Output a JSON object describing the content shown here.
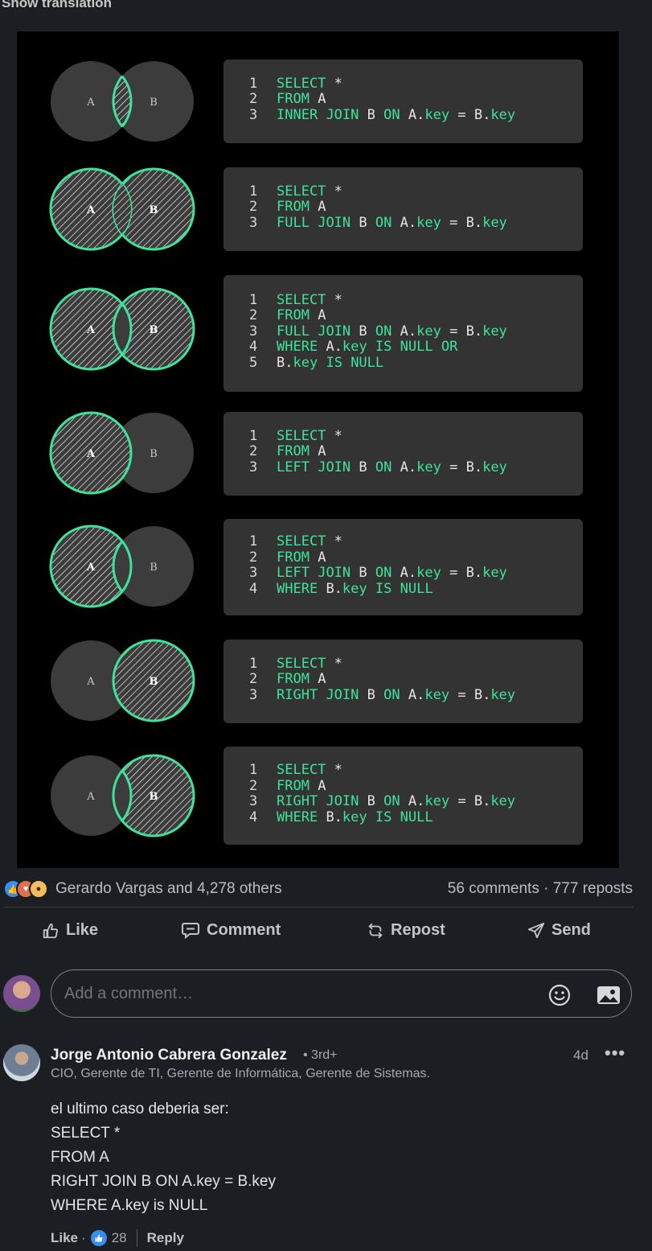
{
  "header": {
    "show_translation": "Show translation"
  },
  "figure": {
    "panels": [
      {
        "left_label": "A",
        "right_label": "B",
        "shade": "inner",
        "code": [
          [
            "1",
            "SELECT *"
          ],
          [
            "2",
            "FROM A"
          ],
          [
            "3",
            "INNER JOIN B ON A.key = B.key"
          ]
        ]
      },
      {
        "left_label": "A",
        "right_label": "B",
        "shade": "full",
        "code": [
          [
            "1",
            "SELECT *"
          ],
          [
            "2",
            "FROM A"
          ],
          [
            "3",
            "FULL JOIN B ON A.key = B.key"
          ]
        ]
      },
      {
        "left_label": "A",
        "right_label": "B",
        "shade": "full-outer",
        "code": [
          [
            "1",
            "SELECT *"
          ],
          [
            "2",
            "FROM A"
          ],
          [
            "3",
            "FULL JOIN B ON A.key = B.key"
          ],
          [
            "4",
            "WHERE A.key IS NULL OR"
          ],
          [
            "5",
            "B.key IS NULL"
          ]
        ]
      },
      {
        "left_label": "A",
        "right_label": "B",
        "shade": "left",
        "code": [
          [
            "1",
            "SELECT *"
          ],
          [
            "2",
            "FROM A"
          ],
          [
            "3",
            "LEFT JOIN B ON A.key = B.key"
          ]
        ]
      },
      {
        "left_label": "A",
        "right_label": "B",
        "shade": "left-only",
        "code": [
          [
            "1",
            "SELECT *"
          ],
          [
            "2",
            "FROM A"
          ],
          [
            "3",
            "LEFT JOIN B ON A.key = B.key"
          ],
          [
            "4",
            "WHERE B.key IS NULL"
          ]
        ]
      },
      {
        "left_label": "A",
        "right_label": "B",
        "shade": "right",
        "code": [
          [
            "1",
            "SELECT *"
          ],
          [
            "2",
            "FROM A"
          ],
          [
            "3",
            "RIGHT JOIN B ON A.key = B.key"
          ]
        ]
      },
      {
        "left_label": "A",
        "right_label": "B",
        "shade": "right-only",
        "code": [
          [
            "1",
            "SELECT *"
          ],
          [
            "2",
            "FROM A"
          ],
          [
            "3",
            "RIGHT JOIN B ON A.key = B.key"
          ],
          [
            "4",
            "WHERE B.key IS NULL"
          ]
        ]
      }
    ],
    "colors": {
      "accent": "#3ee39a",
      "circle": "#3c3c3c",
      "background": "#000000",
      "code_bg": "#333333"
    }
  },
  "social": {
    "reaction_icons": [
      "like-icon",
      "love-icon",
      "insightful-icon"
    ],
    "reactors": "Gerardo Vargas and 4,278 others",
    "stats": "56 comments · 777 reposts"
  },
  "actions": {
    "like": "Like",
    "comment": "Comment",
    "repost": "Repost",
    "send": "Send"
  },
  "composer": {
    "placeholder": "Add a comment…"
  },
  "comment": {
    "author": "Jorge Antonio Cabrera Gonzalez",
    "degree": "• 3rd+",
    "headline": "CIO, Gerente de TI, Gerente de Informática, Gerente de Sistemas.",
    "time": "4d",
    "more": "•••",
    "body": "el ultimo caso deberia ser:\nSELECT *\nFROM A\nRIGHT JOIN B ON A.key = B.key\nWHERE A.key is NULL",
    "like_label": "Like",
    "dot": "·",
    "like_count": "28",
    "reply_label": "Reply"
  }
}
